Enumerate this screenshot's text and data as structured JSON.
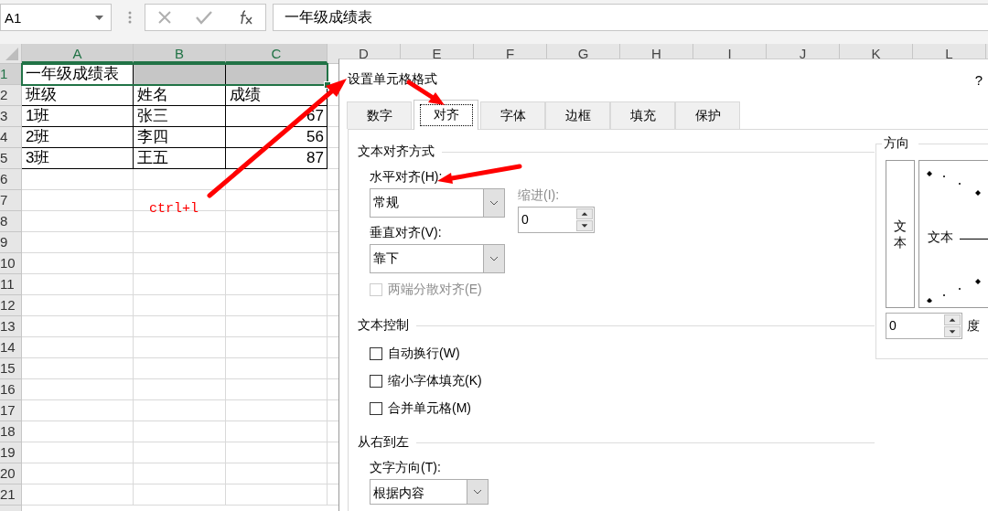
{
  "name_box": {
    "value": "A1"
  },
  "formula_bar": {
    "value": "一年级成绩表"
  },
  "sheet": {
    "columns": [
      {
        "label": "A",
        "selected": true
      },
      {
        "label": "B",
        "selected": true
      },
      {
        "label": "C",
        "selected": true
      },
      {
        "label": "D",
        "selected": false
      },
      {
        "label": "E",
        "selected": false
      },
      {
        "label": "F",
        "selected": false
      },
      {
        "label": "G",
        "selected": false
      },
      {
        "label": "H",
        "selected": false
      },
      {
        "label": "I",
        "selected": false
      },
      {
        "label": "J",
        "selected": false
      },
      {
        "label": "K",
        "selected": false
      },
      {
        "label": "L",
        "selected": false
      }
    ],
    "rows": [
      {
        "label": "1",
        "selected": true,
        "cells": [
          {
            "text": "一年级成绩表",
            "kind": "text",
            "selected": false
          },
          {
            "kind": "empty",
            "selected": true
          },
          {
            "kind": "empty",
            "selected": true
          }
        ]
      },
      {
        "label": "2",
        "selected": false,
        "cells": [
          {
            "text": "班级",
            "kind": "text",
            "selected": false
          },
          {
            "text": "姓名",
            "kind": "text",
            "selected": false
          },
          {
            "text": "成绩",
            "kind": "text",
            "selected": false
          }
        ]
      },
      {
        "label": "3",
        "selected": false,
        "cells": [
          {
            "text": "1班",
            "kind": "text",
            "selected": false
          },
          {
            "text": "张三",
            "kind": "text",
            "selected": false
          },
          {
            "text": "67",
            "kind": "number",
            "selected": false
          }
        ]
      },
      {
        "label": "4",
        "selected": false,
        "cells": [
          {
            "text": "2班",
            "kind": "text",
            "selected": false
          },
          {
            "text": "李四",
            "kind": "text",
            "selected": false
          },
          {
            "text": "56",
            "kind": "number",
            "selected": false
          }
        ]
      },
      {
        "label": "5",
        "selected": false,
        "cells": [
          {
            "text": "3班",
            "kind": "text",
            "selected": false
          },
          {
            "text": "王五",
            "kind": "text",
            "selected": false
          },
          {
            "text": "87",
            "kind": "number",
            "selected": false
          }
        ]
      },
      {
        "label": "6",
        "selected": false
      },
      {
        "label": "7",
        "selected": false
      },
      {
        "label": "8",
        "selected": false
      },
      {
        "label": "9",
        "selected": false
      },
      {
        "label": "10",
        "selected": false
      },
      {
        "label": "11",
        "selected": false
      },
      {
        "label": "12",
        "selected": false
      },
      {
        "label": "13",
        "selected": false
      },
      {
        "label": "14",
        "selected": false
      },
      {
        "label": "15",
        "selected": false
      },
      {
        "label": "16",
        "selected": false
      },
      {
        "label": "17",
        "selected": false
      },
      {
        "label": "18",
        "selected": false
      },
      {
        "label": "19",
        "selected": false
      },
      {
        "label": "20",
        "selected": false
      },
      {
        "label": "21",
        "selected": false
      }
    ]
  },
  "annotation": {
    "text": "ctrl+l"
  },
  "dialog": {
    "title": "设置单元格格式",
    "help": "?",
    "tabs": [
      {
        "label": "数字",
        "selected": false
      },
      {
        "label": "对齐",
        "selected": true
      },
      {
        "label": "字体",
        "selected": false
      },
      {
        "label": "边框",
        "selected": false
      },
      {
        "label": "填充",
        "selected": false
      },
      {
        "label": "保护",
        "selected": false
      }
    ],
    "alignment": {
      "heading": "文本对齐方式",
      "horizontal_label": "水平对齐(H):",
      "horizontal_value": "常规",
      "indent_label": "缩进(I):",
      "indent_disabled": true,
      "indent_value": "0",
      "vertical_label": "垂直对齐(V):",
      "vertical_value": "靠下",
      "justify_distributed": {
        "label": "两端分散对齐(E)",
        "checked": false,
        "disabled": true
      }
    },
    "text_control": {
      "heading": "文本控制",
      "options": [
        {
          "label": "自动换行(W)",
          "checked": false,
          "disabled": false
        },
        {
          "label": "缩小字体填充(K)",
          "checked": false,
          "disabled": false
        },
        {
          "label": "合并单元格(M)",
          "checked": false,
          "disabled": false
        }
      ]
    },
    "right_to_left": {
      "heading": "从右到左",
      "direction_label": "文字方向(T):",
      "direction_value": "根据内容"
    },
    "orientation": {
      "heading": "方向",
      "vertical_text": "文本",
      "dial_text": "文本",
      "degrees_value": "0",
      "degrees_unit": "度"
    }
  }
}
